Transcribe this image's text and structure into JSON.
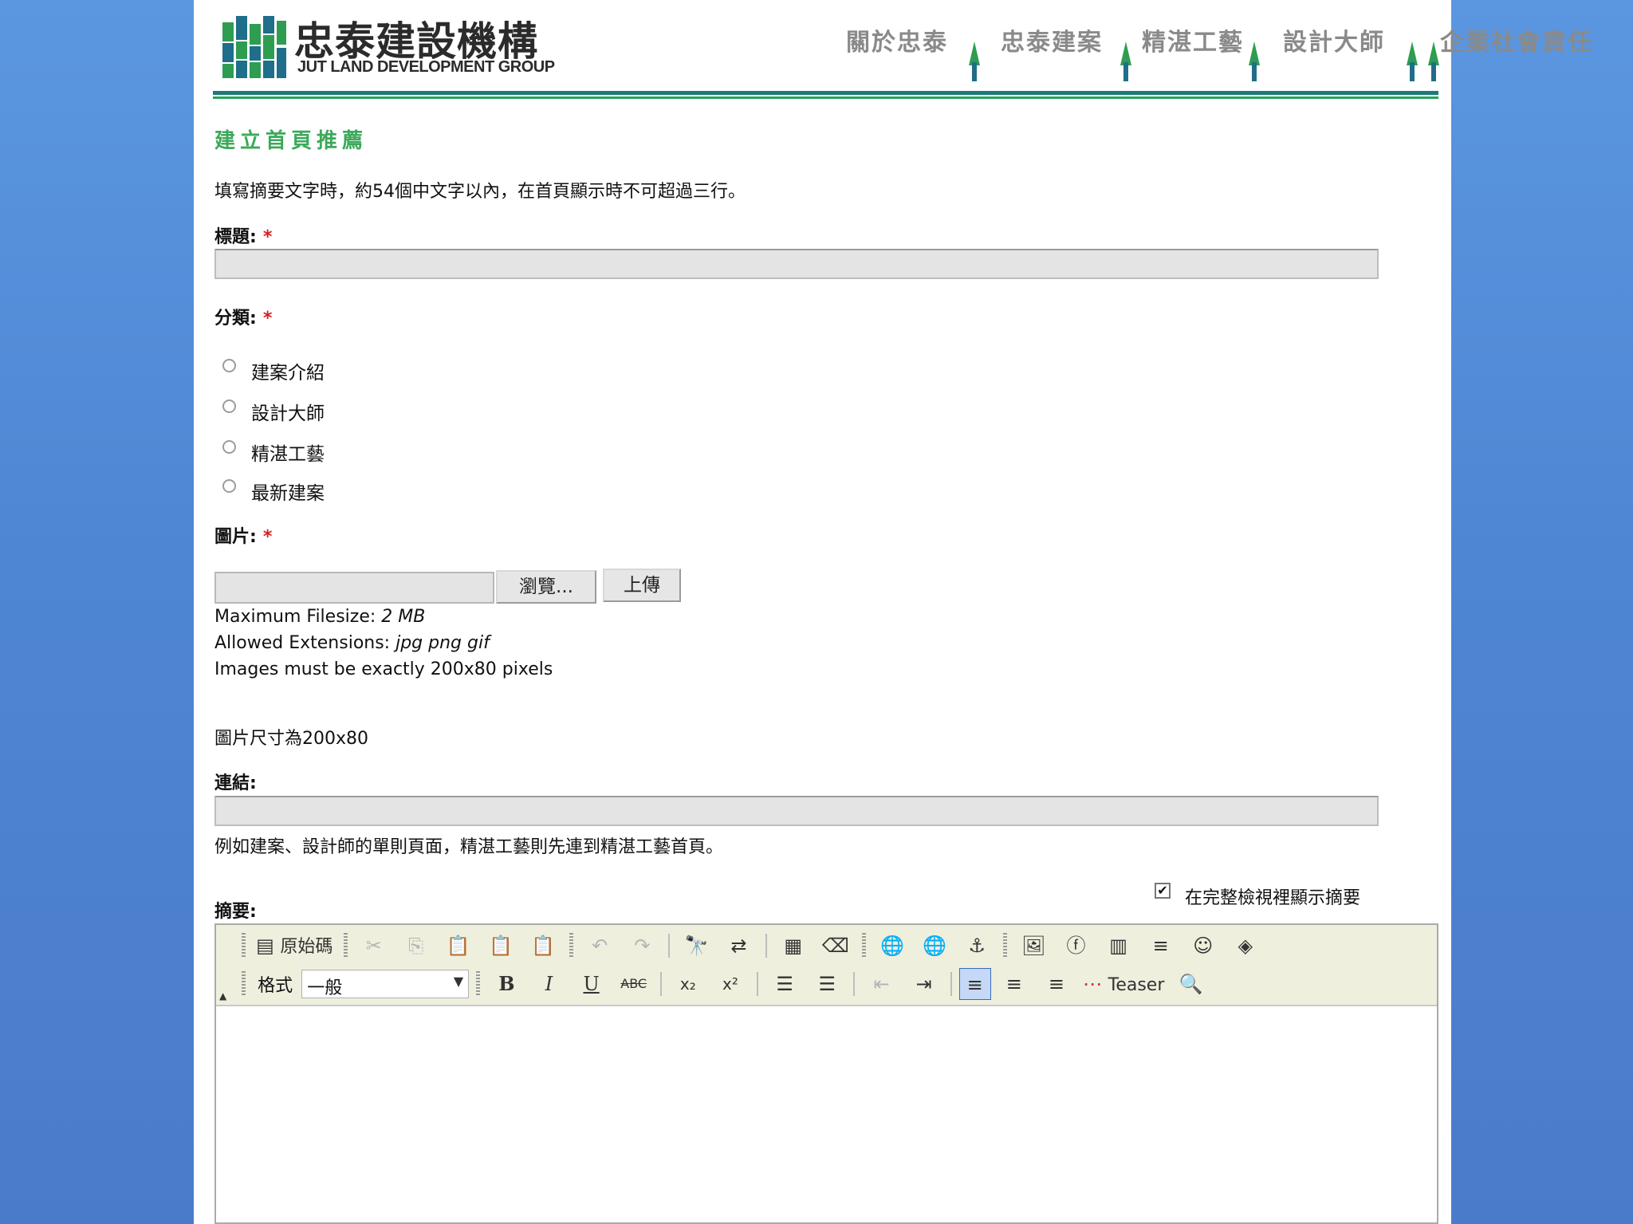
{
  "header": {
    "logo_title": "忠泰建設機構",
    "logo_subtitle": "JUT LAND DEVELOPMENT GROUP",
    "nav": [
      "關於忠泰",
      "忠泰建案",
      "精湛工藝",
      "設計大師",
      "企業社會責任"
    ]
  },
  "form": {
    "section_title": "建立首頁推薦",
    "intro": "填寫摘要文字時，約54個中文字以內，在首頁顯示時不可超過三行。",
    "required_mark": "*",
    "title_label": "標題:",
    "title_value": "",
    "category_label": "分類:",
    "categories": [
      "建案介紹",
      "設計大師",
      "精湛工藝",
      "最新建案"
    ],
    "image_label": "圖片:",
    "file_value": "",
    "browse_button": "瀏覽...",
    "upload_button": "上傳",
    "max_filesize_label": "Maximum Filesize:",
    "max_filesize_value": "2 MB",
    "allowed_ext_label": "Allowed Extensions:",
    "allowed_ext_value": "jpg png gif",
    "image_exact": "Images must be exactly 200x80 pixels",
    "image_size_note": "圖片尺寸為200x80",
    "link_label": "連結:",
    "link_value": "",
    "link_note": "例如建案、設計師的單則頁面，精湛工藝則先連到精湛工藝首頁。",
    "summary_label": "摘要:",
    "show_summary_label": "在完整檢視裡顯示摘要",
    "show_summary_checked": true
  },
  "editor": {
    "source_label": "原始碼",
    "format_label": "格式",
    "format_value": "一般",
    "teaser_label": "Teaser",
    "body": ""
  },
  "colors": {
    "accent_green": "#3ca95a",
    "header_rule": "#1e7a7a",
    "background_blue": "#4f86d4",
    "required_red": "#d81e1e"
  }
}
